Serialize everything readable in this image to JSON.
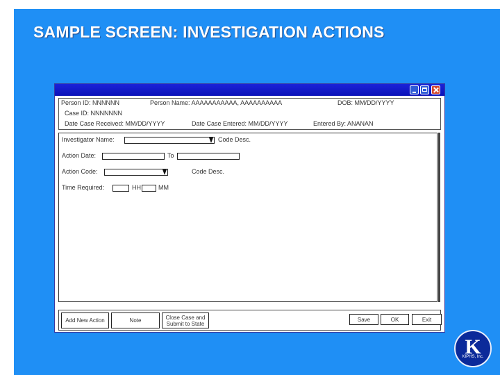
{
  "slide": {
    "title": "SAMPLE SCREEN: INVESTIGATION ACTIONS"
  },
  "info": {
    "person_id": "Person ID: NNNNNN",
    "person_name": "Person Name: AAAAAAAAAAA, AAAAAAAAAA",
    "dob": "DOB: MM/DD/YYYY",
    "case_id": "Case ID: NNNNNNN",
    "date_received": "Date Case Received: MM/DD/YYYY",
    "date_entered": "Date Case Entered: MM/DD/YYYY",
    "entered_by": "Entered By: ANANAN"
  },
  "form": {
    "investigator_label": "Investigator Name:",
    "code_desc_label_1": "Code Desc.",
    "action_date_label": "Action Date:",
    "to_label": "To",
    "action_code_label": "Action Code:",
    "code_desc_label_2": "Code Desc.",
    "time_required_label": "Time Required:",
    "hh_label": "HH",
    "mm_label": "MM"
  },
  "buttons": {
    "add_new_action": "Add New Action",
    "note": "Note",
    "close_case": "Close Case and Submit to State",
    "save": "Save",
    "ok": "OK",
    "exit": "Exit"
  },
  "logo": {
    "letter": "K",
    "name": "KIPHS, Inc."
  },
  "colors": {
    "slide_background": "#1f8ff5",
    "titlebar": "#0b12b8",
    "logo": "#0b2a9a"
  }
}
